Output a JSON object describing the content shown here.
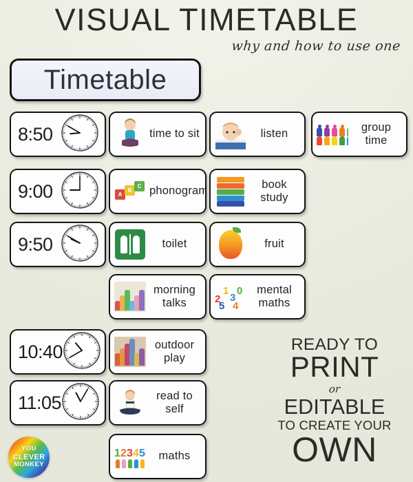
{
  "header": {
    "main_title": "VISUAL TIMETABLE",
    "subtitle": "why and how to use one",
    "card_label": "Timetable"
  },
  "schedule": {
    "rows": [
      {
        "time": "8:50",
        "clock_hour": 8,
        "clock_minute": 50,
        "activities": [
          {
            "label": "time to sit",
            "icon": "girl-sitting-photo"
          },
          {
            "label": "listen",
            "icon": "child-listening-photo"
          },
          {
            "label": "group time",
            "icon": "counting-figures-photo"
          }
        ]
      },
      {
        "time": "9:00",
        "clock_hour": 9,
        "clock_minute": 0,
        "activities": [
          {
            "label": "phonograms",
            "icon": "abc-blocks-photo"
          },
          {
            "label": "book study",
            "icon": "stacked-books-photo"
          }
        ]
      },
      {
        "time": "9:50",
        "clock_hour": 9,
        "clock_minute": 50,
        "activities": [
          {
            "label": "toilet",
            "icon": "toilet-sign-icon"
          },
          {
            "label": "fruit",
            "icon": "fruit-photo"
          }
        ]
      },
      {
        "time": "",
        "clock_hour": null,
        "clock_minute": null,
        "activities": [
          {
            "label": "morning talks",
            "icon": "children-talking-photo"
          },
          {
            "label": "mental maths",
            "icon": "foam-numbers-photo"
          }
        ]
      },
      {
        "time": "10:40",
        "clock_hour": 10,
        "clock_minute": 40,
        "activities": [
          {
            "label": "outdoor play",
            "icon": "children-playing-photo"
          }
        ]
      },
      {
        "time": "11:05",
        "clock_hour": 11,
        "clock_minute": 5,
        "activities": [
          {
            "label": "read to self",
            "icon": "girl-reading-photo"
          }
        ]
      },
      {
        "time": "",
        "clock_hour": null,
        "clock_minute": null,
        "activities": [
          {
            "label": "maths",
            "icon": "number-figures-photo"
          }
        ]
      }
    ]
  },
  "promo": {
    "line1": "READY TO",
    "line2": "PRINT",
    "line3": "or",
    "line4": "EDITABLE",
    "line5": "TO CREATE YOUR",
    "line6": "OWN"
  },
  "logo": {
    "line1": "YOU",
    "line2": "CLEVER",
    "line3": "MONKEY"
  },
  "colors": {
    "background": "#eaecdf",
    "card_border": "#141414",
    "card_fill": "#fdfdfd",
    "text": "#2b2b28",
    "toilet_green": "#2e8b45"
  }
}
